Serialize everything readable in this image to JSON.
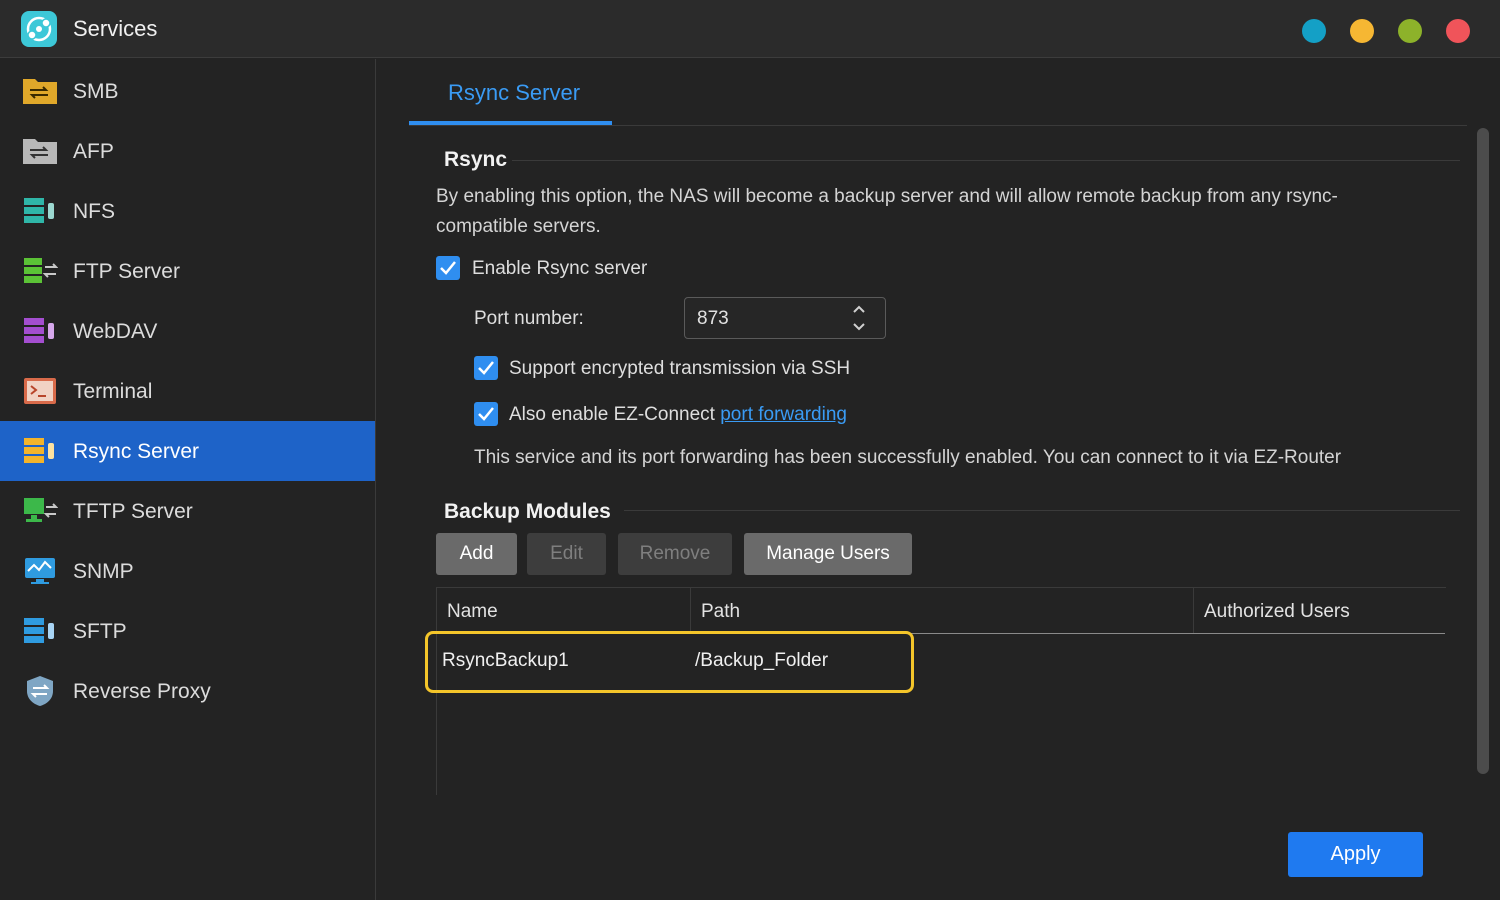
{
  "window": {
    "title": "Services",
    "app_icon": "services-icon",
    "controls": [
      {
        "name": "minimize",
        "color": "#14a0c6"
      },
      {
        "name": "maximize",
        "color": "#f6b733"
      },
      {
        "name": "restore",
        "color": "#8db22a"
      },
      {
        "name": "close",
        "color": "#f0545a"
      }
    ]
  },
  "sidebar": {
    "items": [
      {
        "label": "SMB",
        "icon": "smb-folder-icon",
        "active": false
      },
      {
        "label": "AFP",
        "icon": "afp-folder-icon",
        "active": false
      },
      {
        "label": "NFS",
        "icon": "nfs-server-icon",
        "active": false
      },
      {
        "label": "FTP Server",
        "icon": "ftp-server-icon",
        "active": false
      },
      {
        "label": "WebDAV",
        "icon": "webdav-icon",
        "active": false
      },
      {
        "label": "Terminal",
        "icon": "terminal-icon",
        "active": false
      },
      {
        "label": "Rsync Server",
        "icon": "rsync-server-icon",
        "active": true
      },
      {
        "label": "TFTP Server",
        "icon": "tftp-server-icon",
        "active": false
      },
      {
        "label": "SNMP",
        "icon": "snmp-monitor-icon",
        "active": false
      },
      {
        "label": "SFTP",
        "icon": "sftp-server-icon",
        "active": false
      },
      {
        "label": "Reverse Proxy",
        "icon": "shield-icon",
        "active": false
      }
    ]
  },
  "tabs": [
    {
      "label": "Rsync Server",
      "active": true
    }
  ],
  "rsync": {
    "section_title": "Rsync",
    "description": "By enabling this option, the NAS will become a backup server and will allow remote backup from any rsync-compatible servers.",
    "enable_label": "Enable Rsync server",
    "enable_checked": true,
    "port_label": "Port number:",
    "port_value": "873",
    "ssh_label": "Support encrypted transmission via SSH",
    "ssh_checked": true,
    "ezconnect_label": "Also enable EZ-Connect ",
    "ezconnect_link": "port forwarding",
    "ezconnect_checked": true,
    "status_text": "This service and its port forwarding has been successfully enabled. You can connect to it via EZ-Router"
  },
  "modules": {
    "section_title": "Backup Modules",
    "buttons": {
      "add": "Add",
      "edit": "Edit",
      "remove": "Remove",
      "manage_users": "Manage Users"
    },
    "columns": [
      "Name",
      "Path",
      "Authorized Users"
    ],
    "rows": [
      {
        "name": "RsyncBackup1",
        "path": "/Backup_Folder",
        "users": ""
      }
    ],
    "highlight_color": "#f4c52a"
  },
  "footer": {
    "apply_label": "Apply"
  },
  "colors": {
    "accent": "#2f8ef0",
    "sidebar_active": "#1e63c8",
    "background": "#232323"
  }
}
